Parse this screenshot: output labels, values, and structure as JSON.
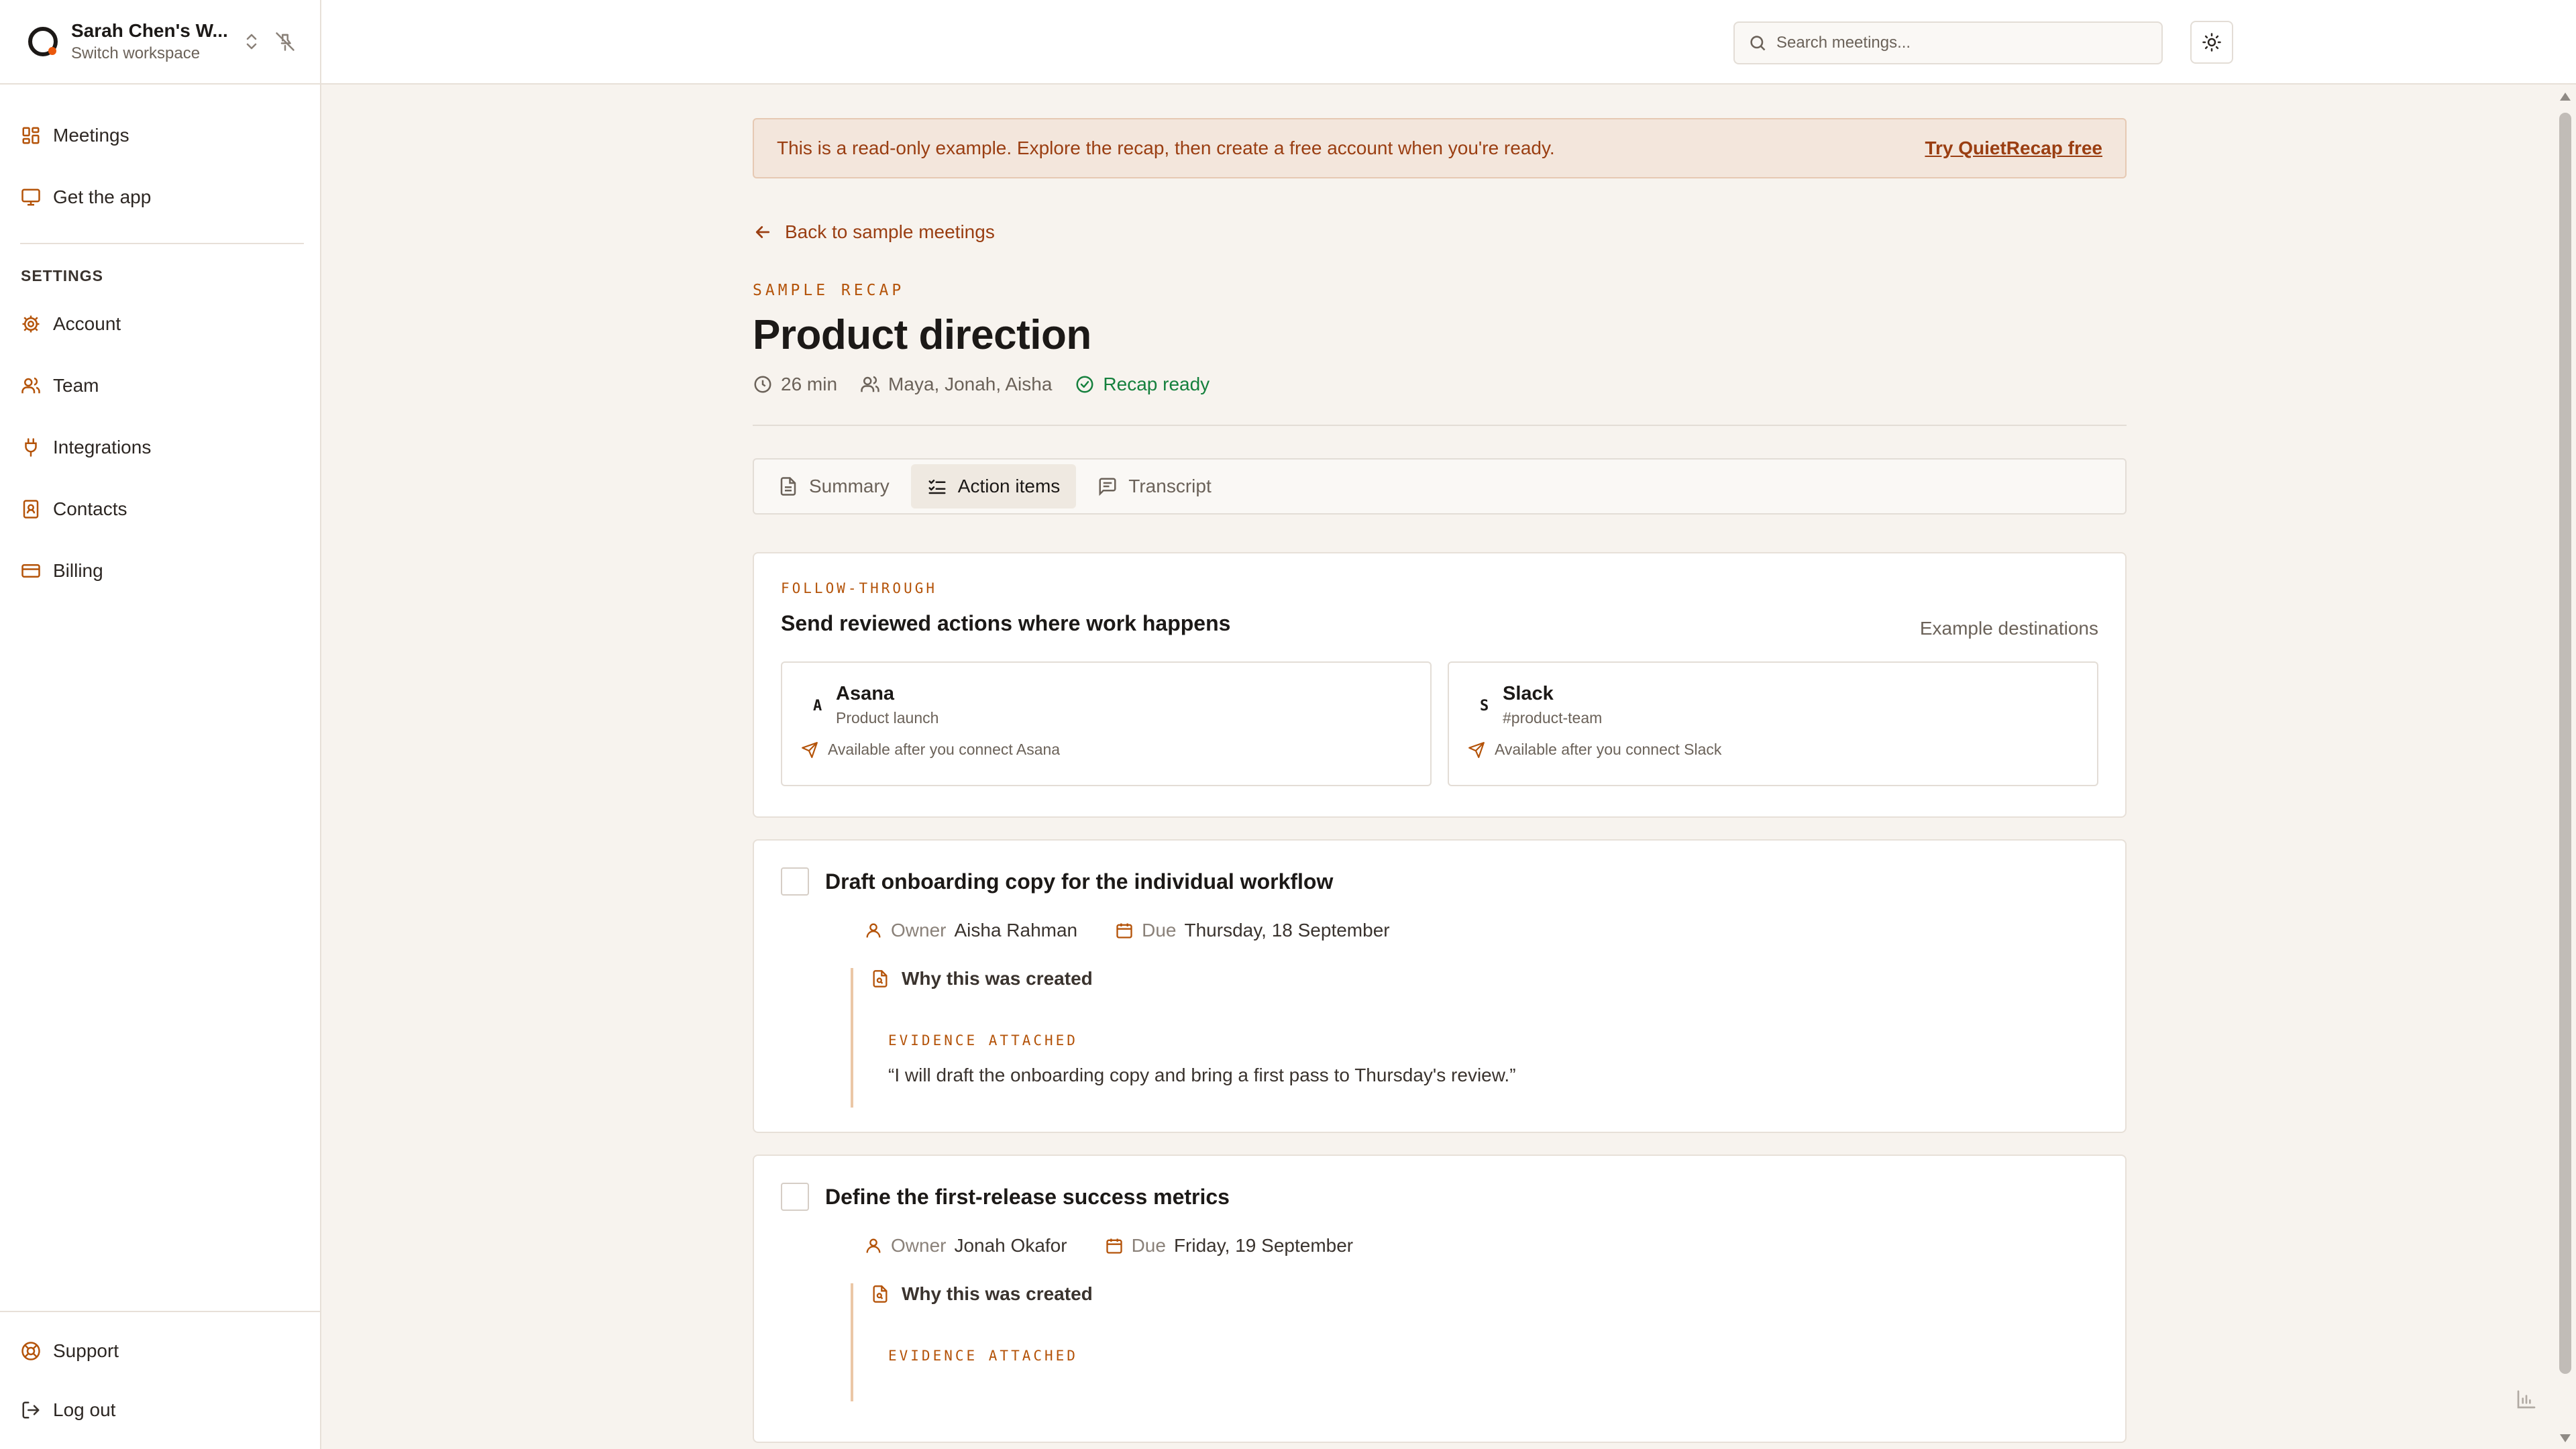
{
  "workspace": {
    "name": "Sarah Chen's W...",
    "sub": "Switch workspace"
  },
  "nav": {
    "items": [
      {
        "label": "Meetings",
        "icon": "dashboard-icon"
      },
      {
        "label": "Get the app",
        "icon": "monitor-icon"
      }
    ],
    "settings_heading": "SETTINGS",
    "settings": [
      {
        "label": "Account",
        "icon": "gear-icon"
      },
      {
        "label": "Team",
        "icon": "users-icon"
      },
      {
        "label": "Integrations",
        "icon": "plug-icon"
      },
      {
        "label": "Contacts",
        "icon": "contact-book-icon"
      },
      {
        "label": "Billing",
        "icon": "credit-card-icon"
      }
    ],
    "bottom": [
      {
        "label": "Support",
        "icon": "lifebuoy-icon"
      },
      {
        "label": "Log out",
        "icon": "logout-icon"
      }
    ]
  },
  "search": {
    "placeholder": "Search meetings..."
  },
  "banner": {
    "text": "This is a read-only example. Explore the recap, then create a free account when you're ready.",
    "link": "Try QuietRecap free"
  },
  "back": "Back to sample meetings",
  "recap": {
    "eyebrow": "SAMPLE RECAP",
    "title": "Product direction",
    "duration": "26 min",
    "attendees": "Maya, Jonah, Aisha",
    "status": "Recap ready"
  },
  "tabs": [
    {
      "label": "Summary",
      "active": false
    },
    {
      "label": "Action items",
      "active": true
    },
    {
      "label": "Transcript",
      "active": false
    }
  ],
  "follow": {
    "eyebrow": "FOLLOW-THROUGH",
    "title": "Send reviewed actions where work happens",
    "dest_label": "Example destinations",
    "destinations": [
      {
        "letter": "A",
        "name": "Asana",
        "sub": "Product launch",
        "note": "Available after you connect Asana"
      },
      {
        "letter": "S",
        "name": "Slack",
        "sub": "#product-team",
        "note": "Available after you connect Slack"
      }
    ]
  },
  "tasks": [
    {
      "title": "Draft onboarding copy for the individual workflow",
      "owner_label": "Owner",
      "owner": "Aisha Rahman",
      "due_label": "Due",
      "due": "Thursday, 18 September",
      "why": "Why this was created",
      "evidence_label": "EVIDENCE ATTACHED",
      "quote": "“I will draft the onboarding copy and bring a first pass to Thursday's review.”"
    },
    {
      "title": "Define the first-release success metrics",
      "owner_label": "Owner",
      "owner": "Jonah Okafor",
      "due_label": "Due",
      "due": "Friday, 19 September",
      "why": "Why this was created",
      "evidence_label": "EVIDENCE ATTACHED",
      "quote": ""
    }
  ],
  "colors": {
    "accent": "#b45309",
    "success": "#15803d",
    "banner_bg": "#f3e6dc"
  }
}
